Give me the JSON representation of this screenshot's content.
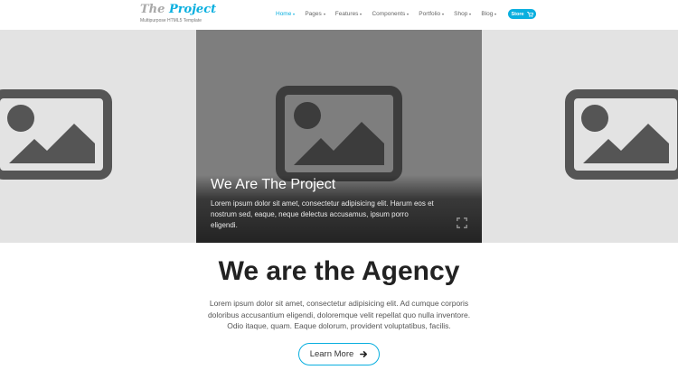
{
  "brand": {
    "logo_the": "The",
    "logo_project": "Project",
    "tagline": "Multipurpose HTML5 Template",
    "accent_color": "#09afdf"
  },
  "nav": {
    "items": [
      {
        "label": "Home",
        "active": true
      },
      {
        "label": "Pages"
      },
      {
        "label": "Features"
      },
      {
        "label": "Components"
      },
      {
        "label": "Portfolio"
      },
      {
        "label": "Shop"
      },
      {
        "label": "Blog"
      }
    ],
    "store_label": "Store",
    "store_icon": "cart-icon"
  },
  "hero": {
    "slide_title": "We Are The Project",
    "slide_text": "Lorem ipsum dolor sit amet, consectetur adipisicing elit. Harum eos et nostrum sed, eaque, neque delectus accusamus, ipsum porro eligendi.",
    "placeholder_icon": "image-placeholder-icon",
    "expand_icon": "expand-icon"
  },
  "intro": {
    "heading": "We are the Agency",
    "text": "Lorem ipsum dolor sit amet, consectetur adipisicing elit. Ad cumque corporis doloribus accusantium eligendi, doloremque velit repellat quo nulla inventore. Odio itaque, quam. Eaque dolorum, provident voluptatibus, facilis.",
    "button_label": "Learn More",
    "button_icon": "arrow-right-icon"
  }
}
